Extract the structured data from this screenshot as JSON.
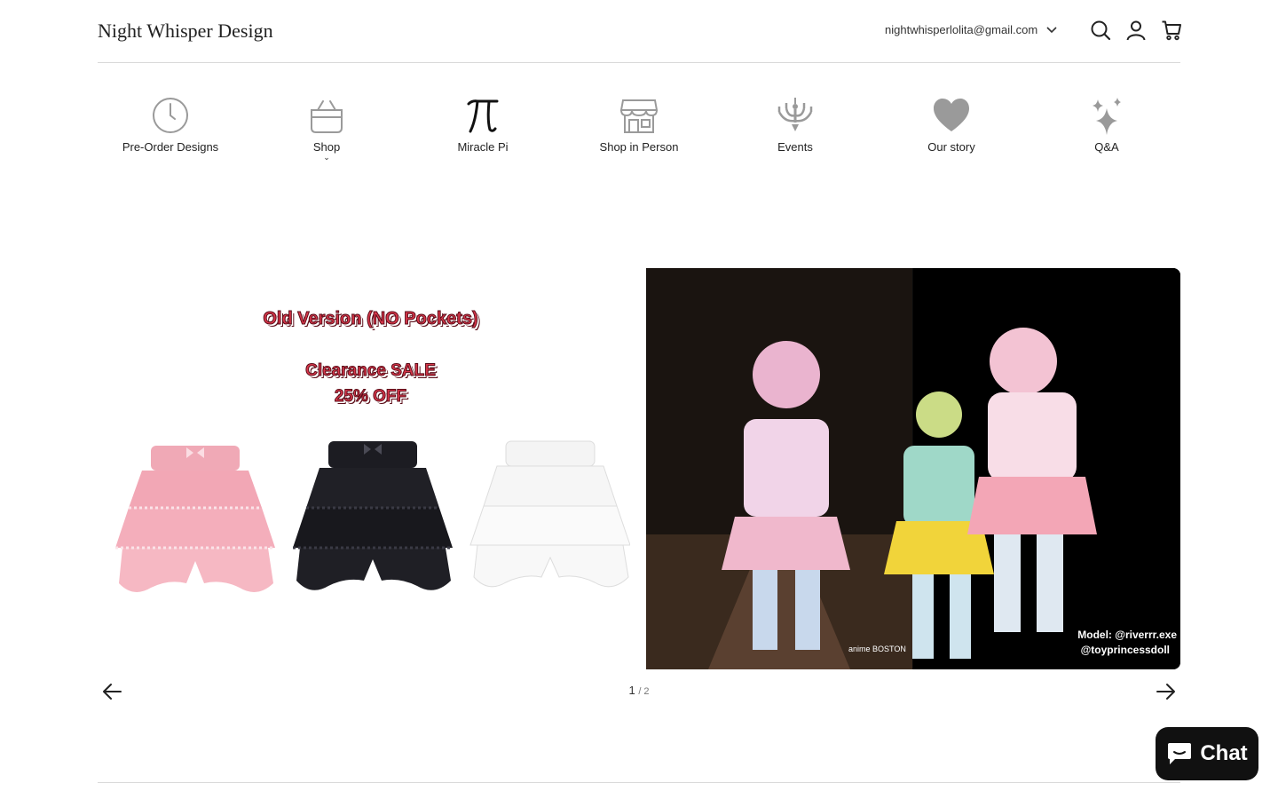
{
  "header": {
    "logo": "Night Whisper Design",
    "account_email": "nightwhisperlolita@gmail.com",
    "icons": [
      "search-icon",
      "user-icon",
      "cart-icon"
    ]
  },
  "nav": {
    "items": [
      {
        "label": "Pre-Order Designs",
        "icon": "clock-icon"
      },
      {
        "label": "Shop",
        "icon": "basket-icon",
        "has_submenu": true
      },
      {
        "label": "Miracle Pi",
        "icon": "pi-icon"
      },
      {
        "label": "Shop in Person",
        "icon": "storefront-icon"
      },
      {
        "label": "Events",
        "icon": "chandelier-icon"
      },
      {
        "label": "Our story",
        "icon": "heart-icon"
      },
      {
        "label": "Q&A",
        "icon": "sparkles-icon"
      }
    ],
    "shop_caret": "⌄"
  },
  "slideshow": {
    "current": "1",
    "total": "/ 2",
    "slide1": {
      "promo_line1": "Old Version (NO Pockets)",
      "promo_line2": "Clearance SALE",
      "promo_line3": "25% OFF"
    },
    "slide2": {
      "watermark": "anime BOSTON",
      "credit_line1": "Model: @riverrr.exe",
      "credit_line2": "@toyprincessdoll"
    }
  },
  "chat": {
    "label": "Chat"
  },
  "colors": {
    "promo_text": "#d8364a",
    "icon_gray": "#9a9a9a",
    "chat_bg": "#111111"
  }
}
